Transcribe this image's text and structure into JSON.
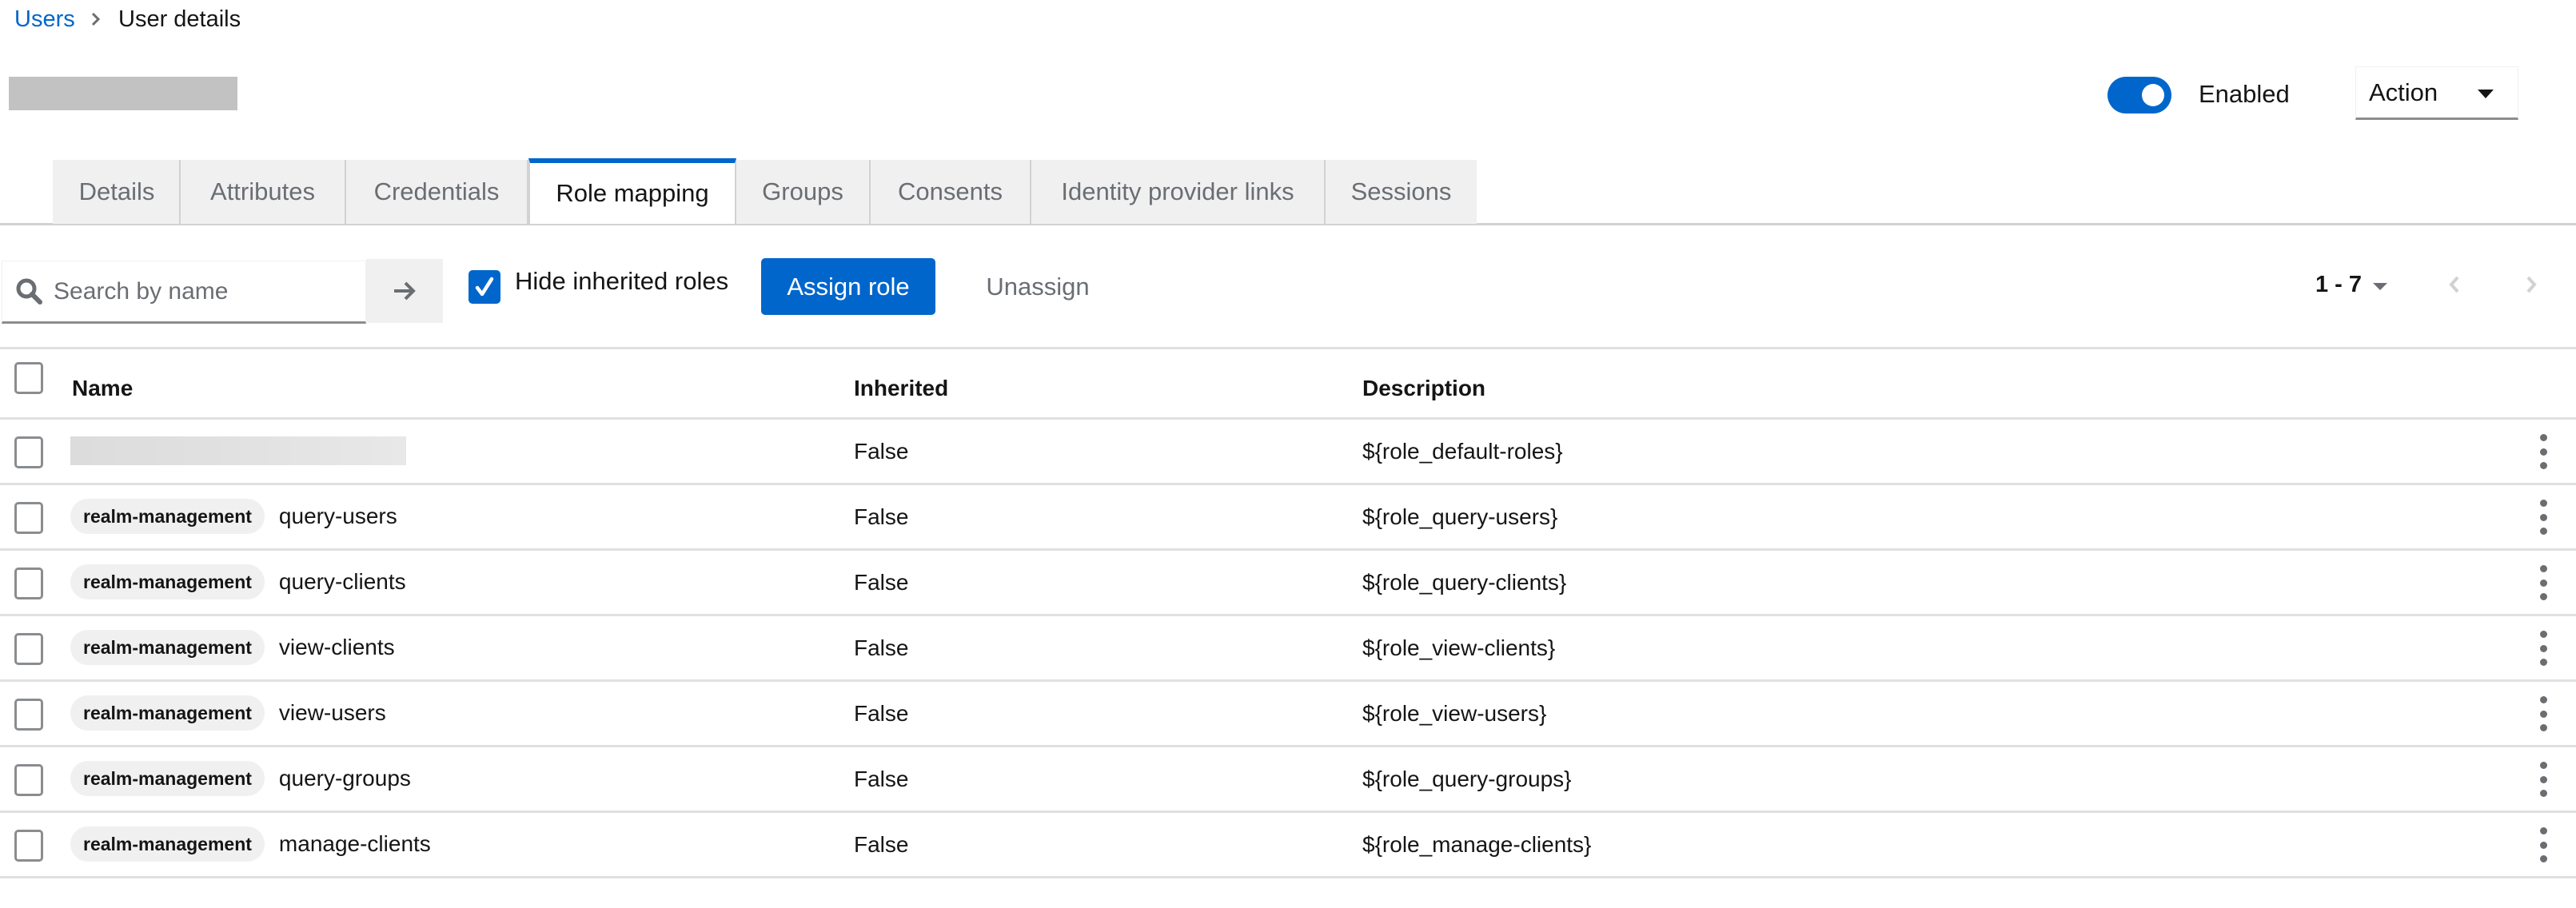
{
  "breadcrumb": {
    "parent": "Users",
    "current": "User details"
  },
  "header": {
    "title_redacted": true,
    "enabled_label": "Enabled",
    "enabled": true,
    "action_label": "Action"
  },
  "tabs": [
    {
      "label": "Details",
      "active": false
    },
    {
      "label": "Attributes",
      "active": false
    },
    {
      "label": "Credentials",
      "active": false
    },
    {
      "label": "Role mapping",
      "active": true
    },
    {
      "label": "Groups",
      "active": false
    },
    {
      "label": "Consents",
      "active": false
    },
    {
      "label": "Identity provider links",
      "active": false
    },
    {
      "label": "Sessions",
      "active": false
    }
  ],
  "toolbar": {
    "search_placeholder": "Search by name",
    "search_value": "",
    "hide_inherited_label": "Hide inherited roles",
    "hide_inherited_checked": true,
    "assign_label": "Assign role",
    "unassign_label": "Unassign",
    "pagination_range": "1 - 7"
  },
  "table": {
    "columns": [
      "Name",
      "Inherited",
      "Description"
    ],
    "rows": [
      {
        "client": "",
        "name": "",
        "redacted": true,
        "inherited": "False",
        "description": "${role_default-roles}"
      },
      {
        "client": "realm-management",
        "name": "query-users",
        "redacted": false,
        "inherited": "False",
        "description": "${role_query-users}"
      },
      {
        "client": "realm-management",
        "name": "query-clients",
        "redacted": false,
        "inherited": "False",
        "description": "${role_query-clients}"
      },
      {
        "client": "realm-management",
        "name": "view-clients",
        "redacted": false,
        "inherited": "False",
        "description": "${role_view-clients}"
      },
      {
        "client": "realm-management",
        "name": "view-users",
        "redacted": false,
        "inherited": "False",
        "description": "${role_view-users}"
      },
      {
        "client": "realm-management",
        "name": "query-groups",
        "redacted": false,
        "inherited": "False",
        "description": "${role_query-groups}"
      },
      {
        "client": "realm-management",
        "name": "manage-clients",
        "redacted": false,
        "inherited": "False",
        "description": "${role_manage-clients}"
      }
    ]
  },
  "colors": {
    "primary": "#0066cc",
    "tab_bg": "#f0f0f0",
    "muted_text": "#6a6e73",
    "border": "#d2d2d2"
  }
}
